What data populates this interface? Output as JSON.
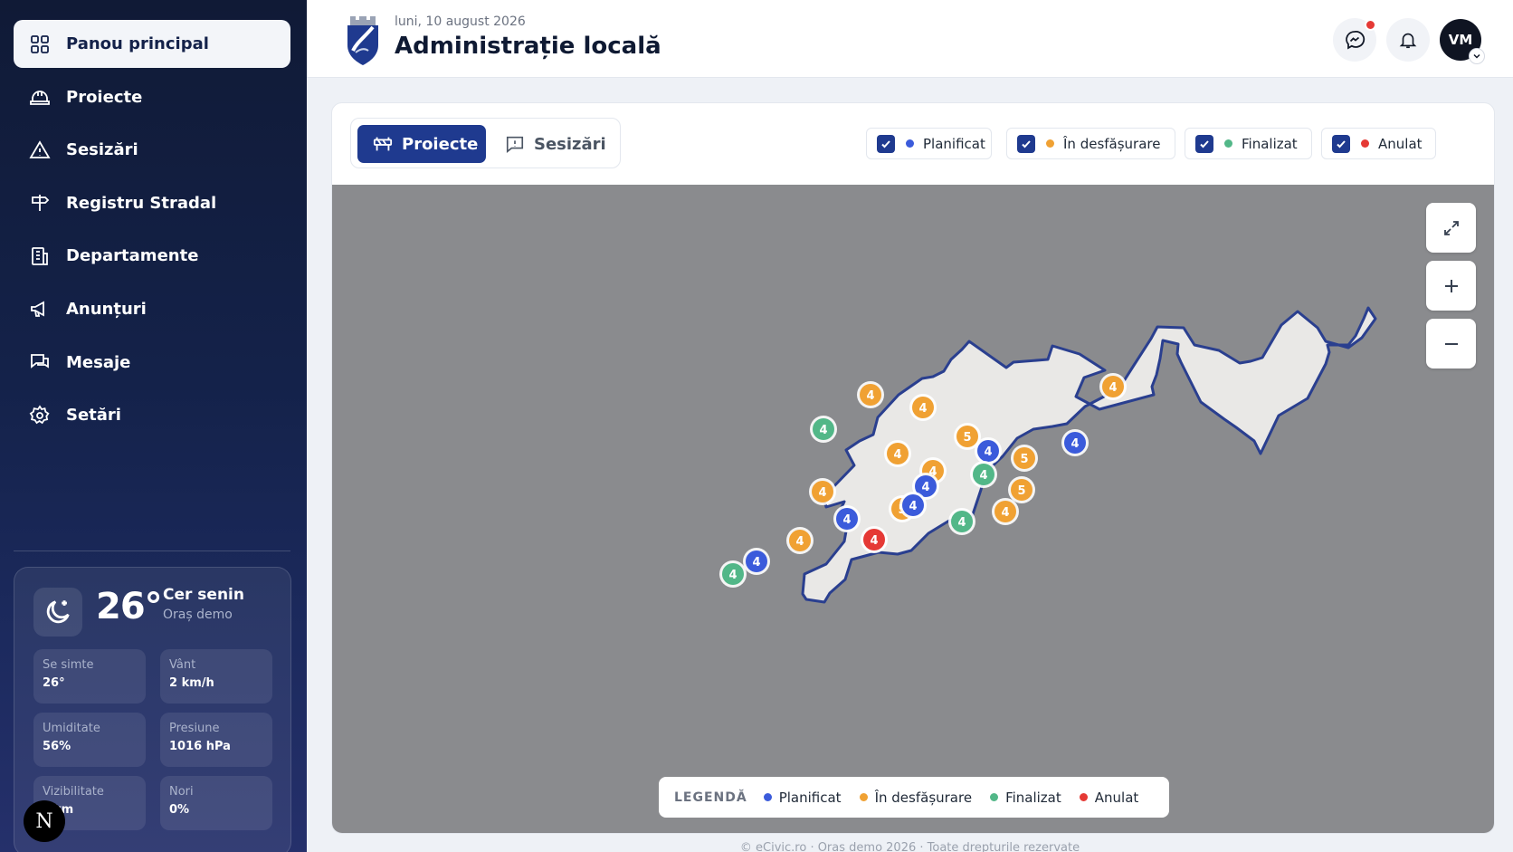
{
  "sidebar": {
    "items": [
      {
        "label": "Panou principal",
        "icon": "grid-icon",
        "active": true
      },
      {
        "label": "Proiecte",
        "icon": "hardhat-icon"
      },
      {
        "label": "Sesizări",
        "icon": "warning-icon"
      },
      {
        "label": "Registru Stradal",
        "icon": "signpost-icon"
      },
      {
        "label": "Departamente",
        "icon": "building-icon"
      },
      {
        "label": "Anunțuri",
        "icon": "megaphone-icon"
      },
      {
        "label": "Mesaje",
        "icon": "chat-icon"
      },
      {
        "label": "Setări",
        "icon": "gear-icon"
      }
    ],
    "weather": {
      "icon": "moon-icon",
      "temp": "26°",
      "condition": "Cer senin",
      "city": "Oraș demo",
      "tiles": [
        {
          "label": "Se simte",
          "value": "26°"
        },
        {
          "label": "Vânt",
          "value": "2 km/h"
        },
        {
          "label": "Umiditate",
          "value": "56%"
        },
        {
          "label": "Presiune",
          "value": "1016 hPa"
        },
        {
          "label": "Vizibilitate",
          "value": "km"
        },
        {
          "label": "Nori",
          "value": "0%"
        }
      ]
    },
    "badge": "N"
  },
  "header": {
    "date": "luni, 10 august 2026",
    "title": "Administrație locală",
    "avatar": "VM"
  },
  "map_panel": {
    "tabs": [
      {
        "label": "Proiecte",
        "active": true
      },
      {
        "label": "Sesizări",
        "active": false
      }
    ],
    "filters": [
      {
        "label": "Planificat",
        "color": "#3b5bdb",
        "checked": true
      },
      {
        "label": "În desfășurare",
        "color": "#f0a133",
        "checked": true
      },
      {
        "label": "Finalizat",
        "color": "#52b788",
        "checked": true
      },
      {
        "label": "Anulat",
        "color": "#e53935",
        "checked": true
      }
    ],
    "legend_title": "LEGENDĂ",
    "legend": [
      {
        "label": "Planificat",
        "color": "#3b5bdb"
      },
      {
        "label": "În desfășurare",
        "color": "#f0a133"
      },
      {
        "label": "Finalizat",
        "color": "#52b788"
      },
      {
        "label": "Anulat",
        "color": "#e53935"
      }
    ],
    "markers": [
      {
        "count": "4",
        "status": "in-progress"
      },
      {
        "count": "4",
        "status": "in-progress"
      },
      {
        "count": "4",
        "status": "in-progress"
      },
      {
        "count": "4",
        "status": "finalized"
      },
      {
        "count": "5",
        "status": "in-progress"
      },
      {
        "count": "4",
        "status": "in-progress"
      },
      {
        "count": "5",
        "status": "in-progress"
      },
      {
        "count": "4",
        "status": "planned"
      },
      {
        "count": "4",
        "status": "planned"
      },
      {
        "count": "5",
        "status": "in-progress"
      },
      {
        "count": "4",
        "status": "in-progress"
      },
      {
        "count": "4",
        "status": "finalized"
      },
      {
        "count": "4",
        "status": "planned"
      },
      {
        "count": "4",
        "status": "in-progress"
      },
      {
        "count": "4",
        "status": "in-progress"
      },
      {
        "count": "4",
        "status": "planned"
      },
      {
        "count": "5",
        "status": "in-progress"
      },
      {
        "count": "4",
        "status": "finalized"
      },
      {
        "count": "4",
        "status": "planned"
      },
      {
        "count": "4",
        "status": "canceled"
      },
      {
        "count": "4",
        "status": "in-progress"
      },
      {
        "count": "4",
        "status": "planned"
      },
      {
        "count": "4",
        "status": "finalized"
      }
    ],
    "controls": [
      "expand-icon",
      "zoom-in-icon",
      "zoom-out-icon"
    ]
  },
  "footer": "© eCivic.ro · Oraș demo 2026 · Toate drepturile rezervate"
}
